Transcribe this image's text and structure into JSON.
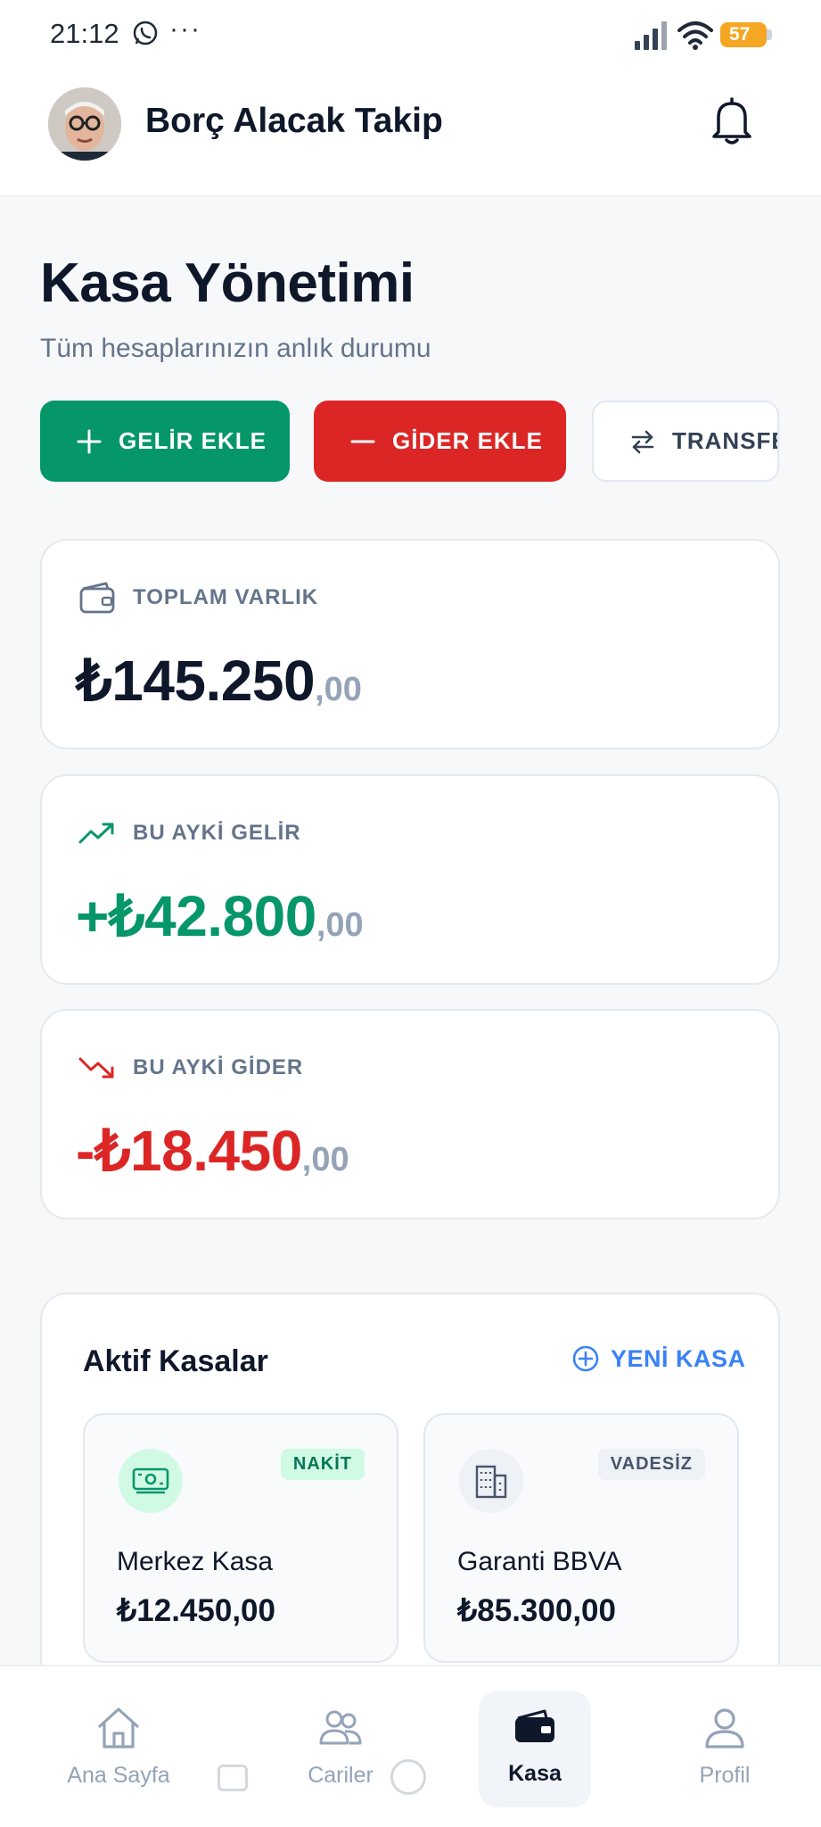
{
  "status_bar": {
    "time": "21:12",
    "dots": "···",
    "battery": "57"
  },
  "header": {
    "title": "Borç Alacak Takip"
  },
  "page": {
    "title": "Kasa Yönetimi",
    "subtitle": "Tüm hesaplarınızın anlık durumu"
  },
  "actions": {
    "income": "GELİR EKLE",
    "expense": "GİDER EKLE",
    "transfer": "TRANSFE"
  },
  "stats": {
    "total": {
      "label": "TOPLAM VARLIK",
      "amount": "₺145.250",
      "cents": ",00"
    },
    "income": {
      "label": "BU AYKİ GELİR",
      "amount": "+₺42.800",
      "cents": ",00"
    },
    "expense": {
      "label": "BU AYKİ GİDER",
      "amount": "-₺18.450",
      "cents": ",00"
    }
  },
  "accounts": {
    "title": "Aktif Kasalar",
    "new_label": "YENİ KASA",
    "items": [
      {
        "badge": "NAKİT",
        "name": "Merkez Kasa",
        "balance": "₺12.450,00",
        "icon": "cash-icon"
      },
      {
        "badge": "VADESİZ",
        "name": "Garanti BBVA",
        "balance": "₺85.300,00",
        "icon": "bank-building-icon"
      }
    ]
  },
  "nav": {
    "items": [
      {
        "label": "Ana Sayfa",
        "icon": "home-icon"
      },
      {
        "label": "Cariler",
        "icon": "users-icon"
      },
      {
        "label": "Kasa",
        "icon": "wallet-icon",
        "active": true
      },
      {
        "label": "Profil",
        "icon": "user-icon"
      }
    ]
  },
  "colors": {
    "income": "#059669",
    "expense": "#dc2626",
    "accent": "#3b82f6",
    "text": "#0f172a",
    "muted": "#64748b"
  }
}
